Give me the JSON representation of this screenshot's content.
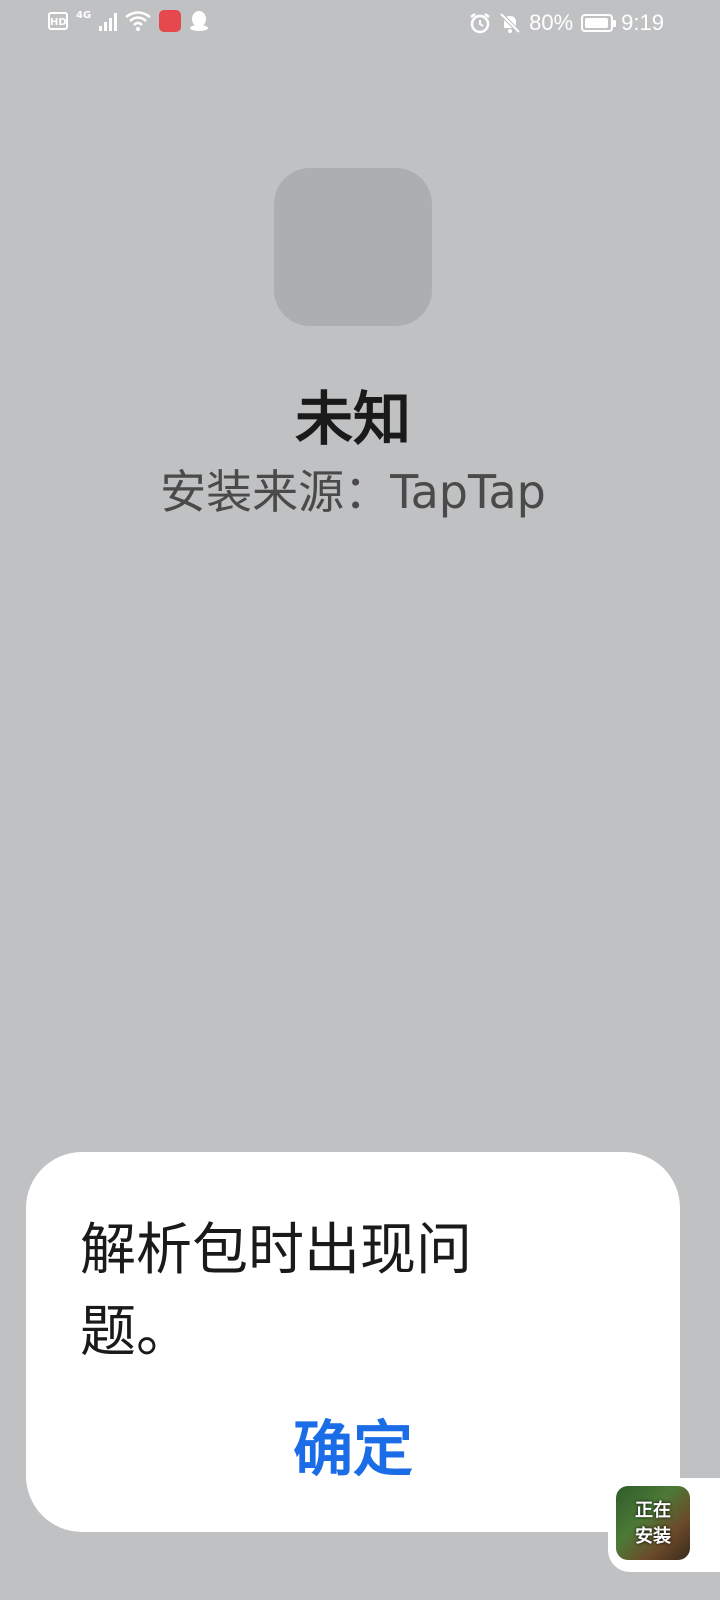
{
  "status_bar": {
    "left_icons": [
      "hd-icon",
      "4g-signal-icon",
      "wifi-icon",
      "huawei-store-icon",
      "qq-icon"
    ],
    "network_label": "4G",
    "hd_label": "HD",
    "battery_text": "80%",
    "time": "9:19",
    "right_icons": [
      "alarm-icon",
      "mute-icon",
      "battery-saver-icon"
    ]
  },
  "app": {
    "name": "未知",
    "install_source": "安装来源：TapTap"
  },
  "dialog": {
    "message": "解析包时出现问题。",
    "confirm_label": "确定"
  },
  "installing_badge": {
    "label_line1": "正在",
    "label_line2": "安装"
  },
  "colors": {
    "background": "#c0c1c3",
    "dialog_bg": "#ffffff",
    "accent": "#1a6de6"
  }
}
